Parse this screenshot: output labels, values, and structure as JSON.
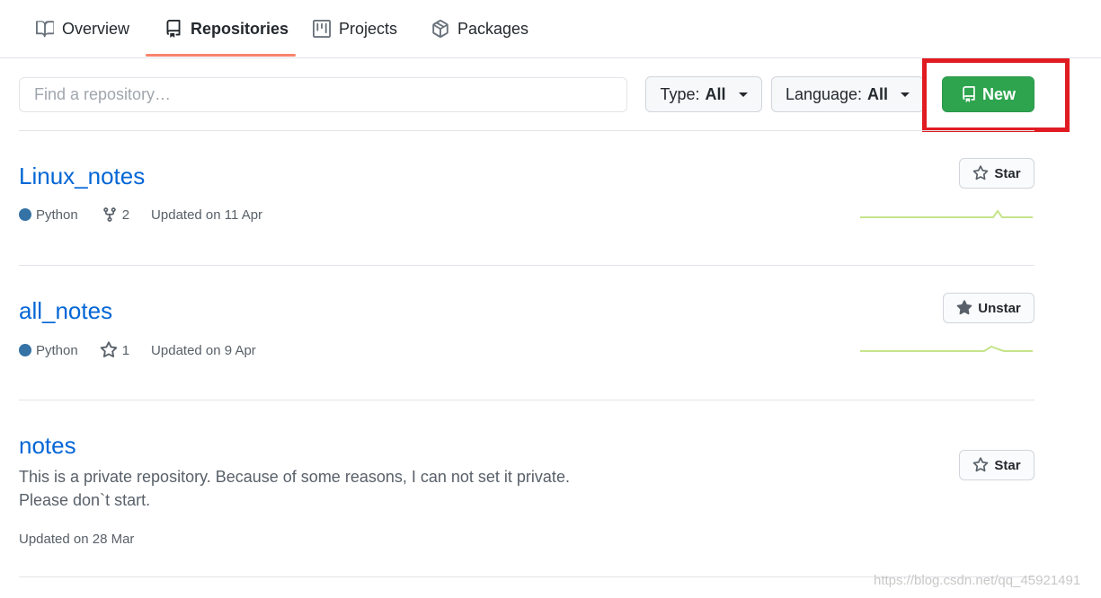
{
  "tabs": [
    {
      "label": "Overview",
      "icon": "book-icon",
      "selected": false
    },
    {
      "label": "Repositories",
      "icon": "repo-icon",
      "selected": true
    },
    {
      "label": "Projects",
      "icon": "project-icon",
      "selected": false
    },
    {
      "label": "Packages",
      "icon": "package-icon",
      "selected": false
    }
  ],
  "filters": {
    "search_placeholder": "Find a repository…",
    "type_label": "Type:",
    "type_value": "All",
    "language_label": "Language:",
    "language_value": "All",
    "new_label": "New"
  },
  "colors": {
    "accent_underline": "#f9826c",
    "link": "#0366d6",
    "new_button": "#2ea44f",
    "highlight_box": "#e11b22",
    "python_language": "#3572A5",
    "sparkline": "#c6e48b"
  },
  "repos": [
    {
      "name": "Linux_notes",
      "language": "Python",
      "stat_icon": "fork-icon",
      "stat_value": "2",
      "updated": "Updated on 11 Apr",
      "star_label": "Star",
      "star_icon": "star-outline-icon"
    },
    {
      "name": "all_notes",
      "language": "Python",
      "stat_icon": "star-outline-icon",
      "stat_value": "1",
      "updated": "Updated on 9 Apr",
      "star_label": "Unstar",
      "star_icon": "star-filled-icon"
    },
    {
      "name": "notes",
      "description_line1": "This is a private repository. Because of some reasons, I can not set it private.",
      "description_line2": "Please don`t start.",
      "updated": "Updated on 28 Mar",
      "star_label": "Star",
      "star_icon": "star-outline-icon"
    }
  ],
  "watermark": "https://blog.csdn.net/qq_45921491"
}
